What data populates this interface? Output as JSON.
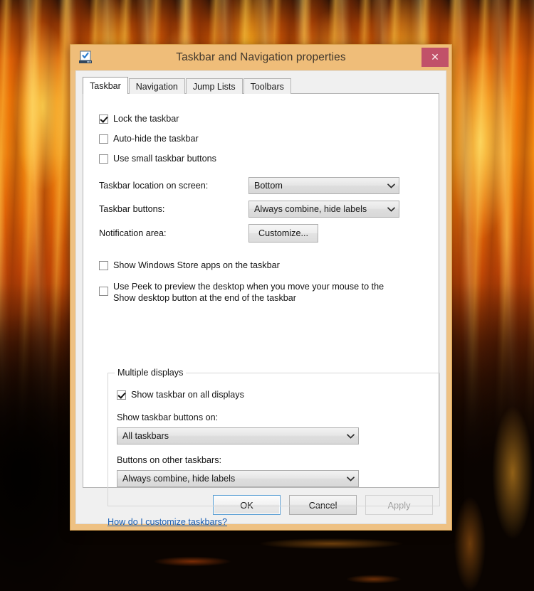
{
  "window": {
    "title": "Taskbar and Navigation properties",
    "icon_name": "taskbar-properties-icon",
    "close_label": "✕",
    "frame_color": "#eec183",
    "titlebar_color": "#efbd79",
    "close_color": "#c15169"
  },
  "tabs": [
    {
      "label": "Taskbar",
      "active": true
    },
    {
      "label": "Navigation",
      "active": false
    },
    {
      "label": "Jump Lists",
      "active": false
    },
    {
      "label": "Toolbars",
      "active": false
    }
  ],
  "taskbar_tab": {
    "checkboxes": [
      {
        "label": "Lock the taskbar",
        "checked": true
      },
      {
        "label": "Auto-hide the taskbar",
        "checked": false
      },
      {
        "label": "Use small taskbar buttons",
        "checked": false
      }
    ],
    "fields": [
      {
        "label": "Taskbar location on screen:",
        "value": "Bottom",
        "type": "combo"
      },
      {
        "label": "Taskbar buttons:",
        "value": "Always combine, hide labels",
        "type": "combo"
      },
      {
        "label": "Notification area:",
        "value": "Customize...",
        "type": "button"
      }
    ],
    "store_apps": {
      "label": "Show Windows Store apps on the taskbar",
      "checked": false
    },
    "peek": {
      "line1": "Use Peek to preview the desktop when you move your mouse to the",
      "line2": "Show desktop button at the end of the taskbar",
      "checked": false
    },
    "multiple_displays": {
      "title": "Multiple displays",
      "show_all": {
        "label": "Show taskbar on all displays",
        "checked": true
      },
      "buttons_on_label": "Show taskbar buttons on:",
      "buttons_on_value": "All taskbars",
      "other_taskbars_label": "Buttons on other taskbars:",
      "other_taskbars_value": "Always combine, hide labels"
    },
    "help_link": "How do I customize taskbars?"
  },
  "footer": {
    "ok": "OK",
    "cancel": "Cancel",
    "apply": "Apply",
    "apply_disabled": true
  },
  "icons": {
    "chevron_down": "⌄"
  }
}
